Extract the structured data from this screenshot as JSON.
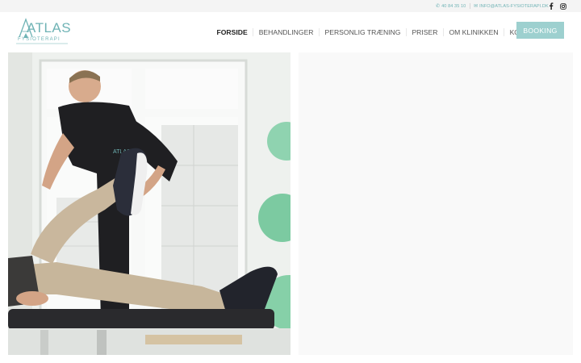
{
  "topbar": {
    "phone_icon": "phone-icon",
    "phone": "40 84 35 10",
    "email_icon": "envelope-icon",
    "email": "INFO@ATLAS-FYSIOTERAPI.DK",
    "social": [
      "facebook-icon",
      "instagram-icon"
    ]
  },
  "header": {
    "logo": {
      "word": "ATLAS",
      "sub": "FYSIOTERAPI"
    },
    "nav": [
      {
        "label": "FORSIDE",
        "active": true
      },
      {
        "label": "BEHANDLINGER",
        "active": false
      },
      {
        "label": "PERSONLIG TRÆNING",
        "active": false
      },
      {
        "label": "PRISER",
        "active": false
      },
      {
        "label": "OM KLINIKKEN",
        "active": false
      },
      {
        "label": "KONTAKT",
        "active": false
      }
    ],
    "booking_label": "BOOKING"
  },
  "hero": {
    "shirt_logo": "ATLAS"
  },
  "colors": {
    "accent": "#6fb3b5",
    "booking_bg": "#9dd0cf",
    "panel_bg": "#f9f9f9",
    "topbar_bg": "#f4f4f4"
  }
}
